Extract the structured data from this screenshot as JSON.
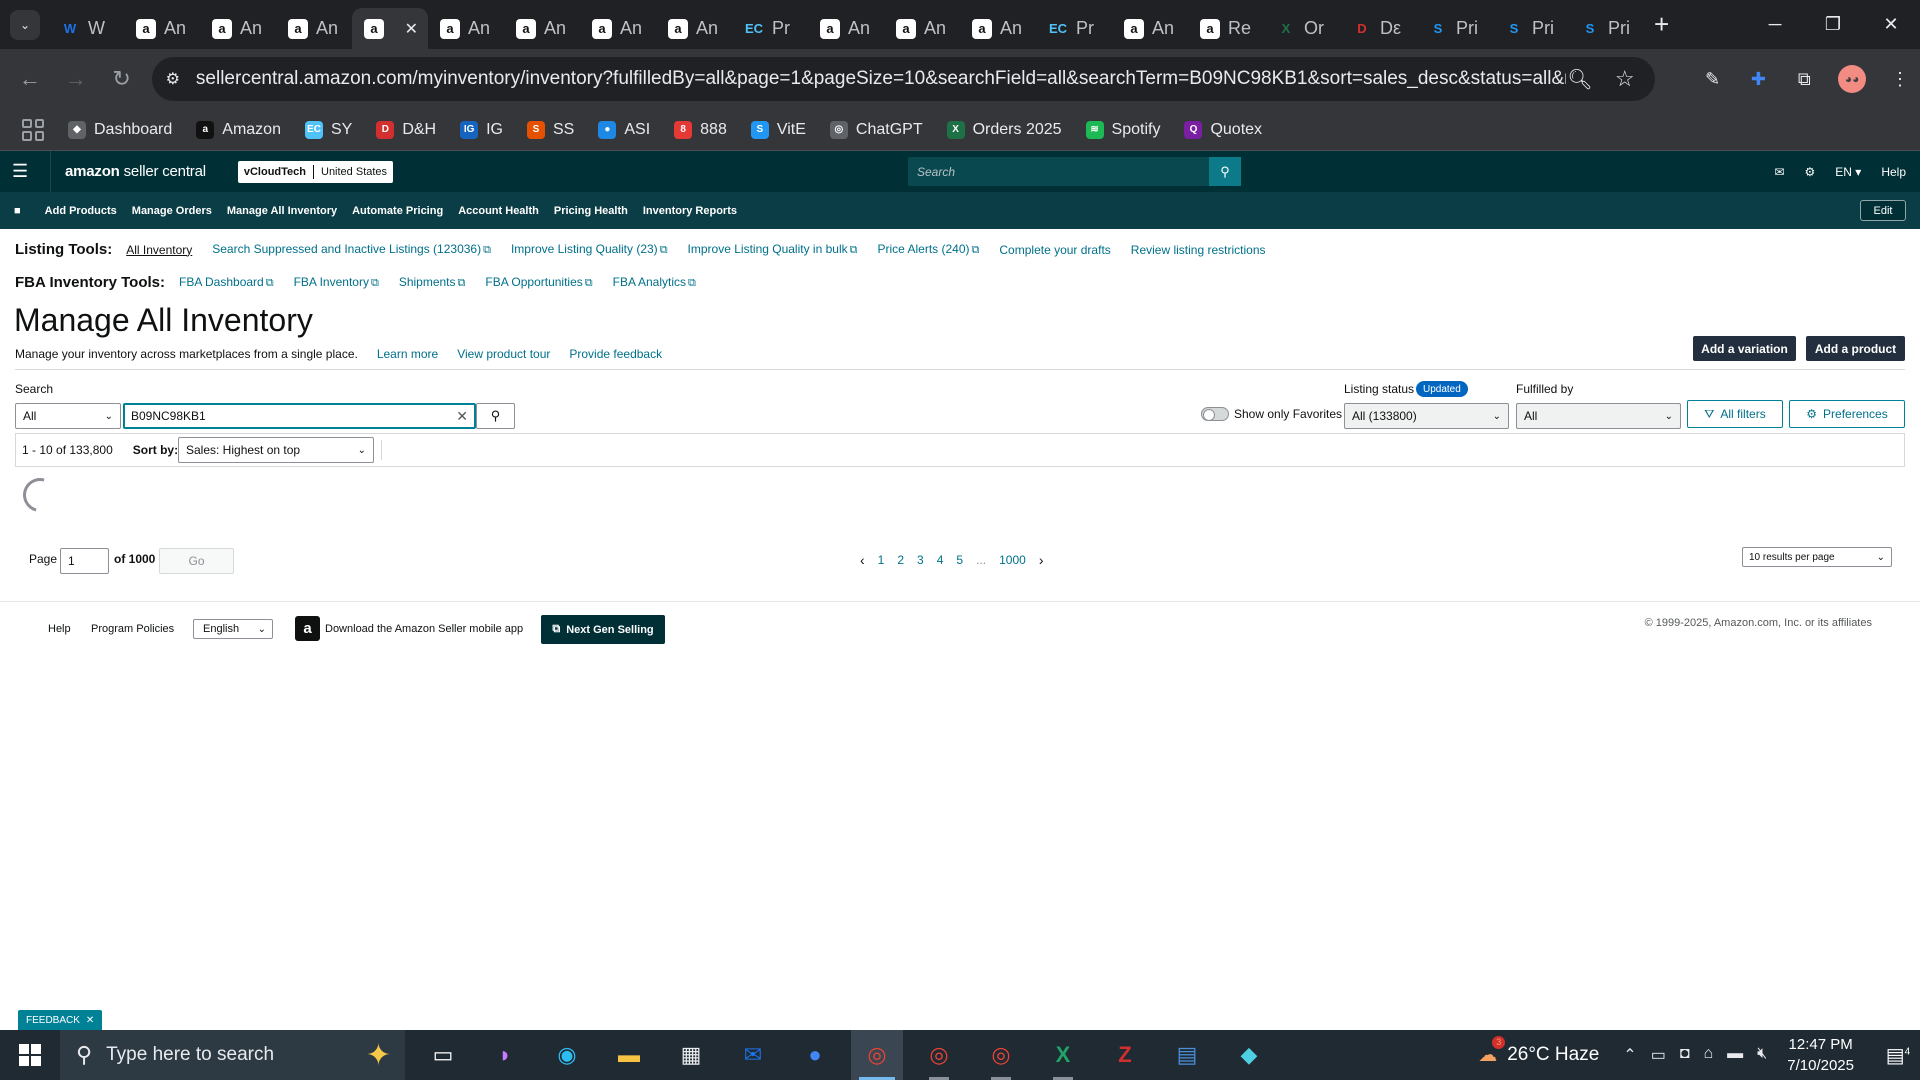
{
  "browser": {
    "tabs": [
      {
        "favicon": "W",
        "fav_color": "#1a73e8",
        "title": "W"
      },
      {
        "favicon": "a",
        "fav_color": "#ffffff",
        "title": "An"
      },
      {
        "favicon": "a",
        "fav_color": "#ffffff",
        "title": "An"
      },
      {
        "favicon": "a",
        "fav_color": "#ffffff",
        "title": "An"
      },
      {
        "favicon": "a",
        "fav_color": "#ffffff",
        "title": "",
        "active": true
      },
      {
        "favicon": "a",
        "fav_color": "#ffffff",
        "title": "An"
      },
      {
        "favicon": "a",
        "fav_color": "#ffffff",
        "title": "An"
      },
      {
        "favicon": "a",
        "fav_color": "#ffffff",
        "title": "An"
      },
      {
        "favicon": "a",
        "fav_color": "#ffffff",
        "title": "An"
      },
      {
        "favicon": "EC",
        "fav_color": "#4fc3f7",
        "title": "Pr"
      },
      {
        "favicon": "a",
        "fav_color": "#ffffff",
        "title": "An"
      },
      {
        "favicon": "a",
        "fav_color": "#ffffff",
        "title": "An"
      },
      {
        "favicon": "a",
        "fav_color": "#ffffff",
        "title": "An"
      },
      {
        "favicon": "EC",
        "fav_color": "#4fc3f7",
        "title": "Pr"
      },
      {
        "favicon": "a",
        "fav_color": "#ffffff",
        "title": "An"
      },
      {
        "favicon": "a",
        "fav_color": "#ffffff",
        "title": "Re"
      },
      {
        "favicon": "X",
        "fav_color": "#1e7145",
        "title": "Or"
      },
      {
        "favicon": "D",
        "fav_color": "#d32f2f",
        "title": "Dε"
      },
      {
        "favicon": "S",
        "fav_color": "#2196f3",
        "title": "Pri"
      },
      {
        "favicon": "S",
        "fav_color": "#2196f3",
        "title": "Pri"
      },
      {
        "favicon": "S",
        "fav_color": "#2196f3",
        "title": "Pri"
      }
    ],
    "new_tab": "+",
    "url": "sellercentral.amazon.com/myinventory/inventory?fulfilledBy=all&page=1&pageSize=10&searchField=all&searchTerm=B09NC98KB1&sort=sales_desc&status=all&ref_=xx_inv...",
    "bookmarks": [
      {
        "label": "Dashboard",
        "icon_color": "#5f6368",
        "glyph": "◆"
      },
      {
        "label": "Amazon",
        "icon_color": "#111111",
        "glyph": "a"
      },
      {
        "label": "SY",
        "icon_color": "#4fc3f7",
        "glyph": "EC"
      },
      {
        "label": "D&H",
        "icon_color": "#d32f2f",
        "glyph": "D"
      },
      {
        "label": "IG",
        "icon_color": "#1565c0",
        "glyph": "IG"
      },
      {
        "label": "SS",
        "icon_color": "#e65100",
        "glyph": "S"
      },
      {
        "label": "ASI",
        "icon_color": "#1e88e5",
        "glyph": "●"
      },
      {
        "label": "888",
        "icon_color": "#e53935",
        "glyph": "8"
      },
      {
        "label": "VitE",
        "icon_color": "#2196f3",
        "glyph": "S"
      },
      {
        "label": "ChatGPT",
        "icon_color": "#5f6368",
        "glyph": "◎"
      },
      {
        "label": "Orders 2025",
        "icon_color": "#1e7145",
        "glyph": "X"
      },
      {
        "label": "Spotify",
        "icon_color": "#1db954",
        "glyph": "≋"
      },
      {
        "label": "Quotex",
        "icon_color": "#7b1fa2",
        "glyph": "Q"
      }
    ]
  },
  "sc": {
    "logo_bold": "amazon",
    "logo_light": " seller central",
    "store": "vCloudTech",
    "region": "United States",
    "search_placeholder": "Search",
    "lang": "EN ▾",
    "help": "Help",
    "nav": [
      "Add Products",
      "Manage Orders",
      "Manage All Inventory",
      "Automate Pricing",
      "Account Health",
      "Pricing Health",
      "Inventory Reports"
    ],
    "edit": "Edit"
  },
  "listing_tools": {
    "label": "Listing Tools:",
    "links": [
      {
        "text": "All Inventory",
        "active": true,
        "ext": false
      },
      {
        "text": "Search Suppressed and Inactive Listings (123036)",
        "ext": true
      },
      {
        "text": "Improve Listing Quality (23)",
        "ext": true
      },
      {
        "text": "Improve Listing Quality in bulk",
        "ext": true
      },
      {
        "text": "Price Alerts (240)",
        "ext": true
      },
      {
        "text": "Complete your drafts",
        "ext": false
      },
      {
        "text": "Review listing restrictions",
        "ext": false
      }
    ]
  },
  "fba_tools": {
    "label": "FBA Inventory Tools:",
    "links": [
      {
        "text": "FBA Dashboard",
        "ext": true
      },
      {
        "text": "FBA Inventory",
        "ext": true
      },
      {
        "text": "Shipments",
        "ext": true
      },
      {
        "text": "FBA Opportunities",
        "ext": true
      },
      {
        "text": "FBA Analytics",
        "ext": true
      }
    ]
  },
  "page": {
    "title": "Manage All Inventory",
    "subtitle": "Manage your inventory across marketplaces from a single place.",
    "learn_more": "Learn more",
    "tour": "View product tour",
    "feedback": "Provide feedback",
    "add_variation": "Add a variation",
    "add_product": "Add a product"
  },
  "filters": {
    "search_label": "Search",
    "search_field": "All",
    "search_value": "B09NC98KB1",
    "show_favorites": "Show only Favorites",
    "listing_status_label": "Listing status",
    "updated_badge": "Updated",
    "listing_status_value": "All (133800)",
    "fulfilled_by_label": "Fulfilled by",
    "fulfilled_by_value": "All",
    "all_filters": "All filters",
    "preferences": "Preferences"
  },
  "results": {
    "count": "1 - 10 of 133,800",
    "sort_label": "Sort by:",
    "sort_value": "Sales: Highest on top"
  },
  "pagination": {
    "page_label": "Page",
    "page_value": "1",
    "of_label": "of 1000",
    "go": "Go",
    "pages": [
      "1",
      "2",
      "3",
      "4",
      "5",
      "...",
      "1000"
    ],
    "per_page": "10 results per page"
  },
  "footer": {
    "help": "Help",
    "policies": "Program Policies",
    "language": "English",
    "mobile_app": "Download the Amazon Seller mobile app",
    "next_gen": "Next Gen Selling",
    "copyright": "© 1999-2025, Amazon.com, Inc. or its affiliates"
  },
  "feedback_tab": "FEEDBACK",
  "taskbar": {
    "search_placeholder": "Type here to search",
    "weather": "26°C  Haze",
    "time": "12:47 PM",
    "date": "7/10/2025",
    "notifications": "4",
    "weather_badge": "3"
  }
}
